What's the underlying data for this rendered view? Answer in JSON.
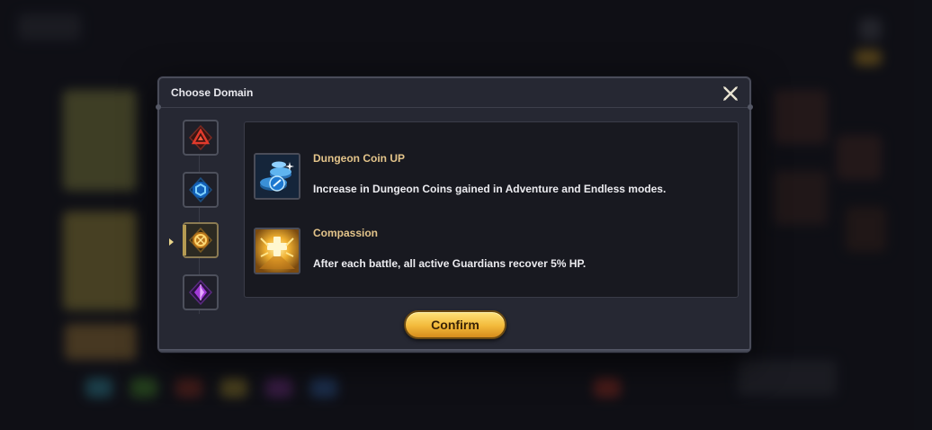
{
  "dialog": {
    "title": "Choose Domain",
    "close_icon": "close-x-icon",
    "confirm_label": "Confirm"
  },
  "domains": [
    {
      "icon": "red-triangle-domain-icon",
      "color": "#d9352a",
      "selected": false
    },
    {
      "icon": "blue-hexagon-domain-icon",
      "color": "#2d8de8",
      "selected": false
    },
    {
      "icon": "gold-emblem-domain-icon",
      "color": "#e6a22a",
      "selected": true
    },
    {
      "icon": "purple-crystal-domain-icon",
      "color": "#b03be0",
      "selected": false
    }
  ],
  "effects": [
    {
      "name": "Dungeon Coin UP",
      "description": "Increase in Dungeon Coins gained in Adventure and Endless modes.",
      "icon": "dungeon-coin-icon"
    },
    {
      "name": "Compassion",
      "description": "After each battle, all active Guardians recover 5% HP.",
      "icon": "compassion-heal-icon"
    }
  ],
  "colors": {
    "accent_gold": "#e3c48a",
    "button_gold": "#f2b93a"
  }
}
